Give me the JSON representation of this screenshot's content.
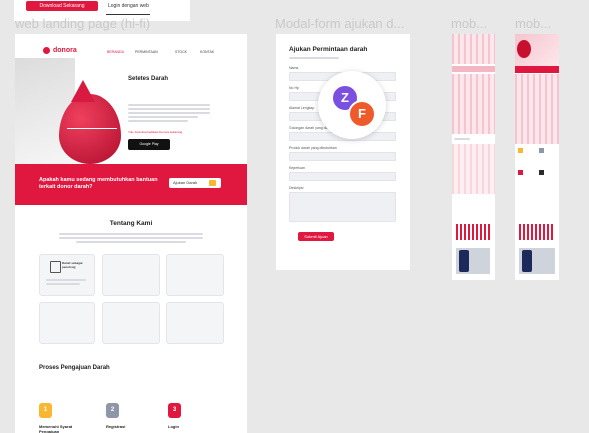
{
  "top_toolbar": {
    "download_button": "Download Sekarang",
    "login_text": "Login dengan web"
  },
  "frame_titles": {
    "landing": "web landing page (hi-fi)",
    "modal": "Modal-form ajukan d...",
    "mob1": "mob...",
    "mob2": "mob..."
  },
  "landing": {
    "logo_text": "donora",
    "nav": [
      "BERANDA",
      "PERMINTAAN",
      "STOCK",
      "KONTAK"
    ],
    "hero_title": "Setetes Darah",
    "hero_cta": "Yuk, download aplikasi Donora sekarang",
    "store_badge": "Google Play",
    "banner_text": "Apakah kamu sedang membutuhkan bantuan terkait donor darah?",
    "banner_button": "Ajukan Darah",
    "about_title": "Tentang Kami",
    "about_card_title": "Darah sebagai penolong",
    "process_title": "Proses Pengajuan Darah",
    "steps": [
      {
        "num": "1",
        "label": "Memenuhi Syarat Pengajuan",
        "color": "#f7b731"
      },
      {
        "num": "2",
        "label": "Registrasi",
        "color": "#8e96a8"
      },
      {
        "num": "3",
        "label": "Login",
        "color": "#e0173f"
      }
    ]
  },
  "modal": {
    "title": "Ajukan Permintaan darah",
    "fields": [
      "Nama",
      "No Hp",
      "Alamat Lengkap",
      "Golongan darah yang dibutuhkan",
      "Produk darah yang dibutuhkan",
      "Keperluan",
      "Deskripsi"
    ],
    "submit": "Submit Ajuan"
  },
  "avatars": [
    {
      "letter": "Z",
      "color": "#7b4fe0"
    },
    {
      "letter": "F",
      "color": "#ef5a2a"
    }
  ],
  "colors": {
    "brand_red": "#e0173f",
    "canvas": "#e8e8e8"
  }
}
